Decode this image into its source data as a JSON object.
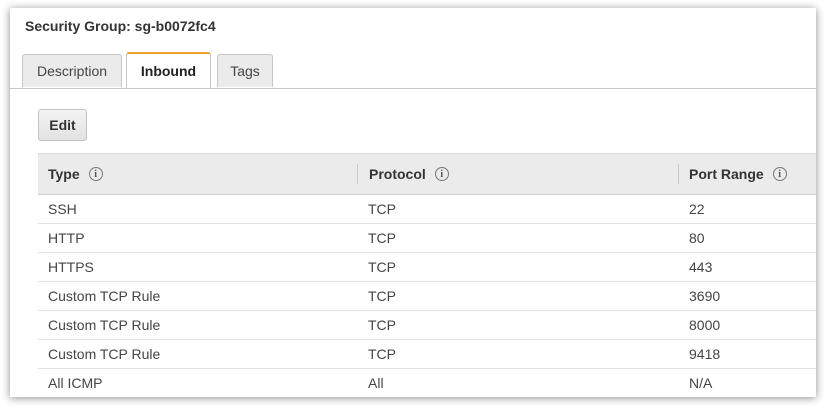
{
  "panel": {
    "title": "Security Group: sg-b0072fc4"
  },
  "tabs": [
    {
      "label": "Description",
      "active": false
    },
    {
      "label": "Inbound",
      "active": true
    },
    {
      "label": "Tags",
      "active": false
    }
  ],
  "toolbar": {
    "edit_label": "Edit"
  },
  "table": {
    "columns": [
      "Type",
      "Protocol",
      "Port Range"
    ],
    "info_icon": "info-icon",
    "rows": [
      {
        "type": "SSH",
        "protocol": "TCP",
        "port": "22"
      },
      {
        "type": "HTTP",
        "protocol": "TCP",
        "port": "80"
      },
      {
        "type": "HTTPS",
        "protocol": "TCP",
        "port": "443"
      },
      {
        "type": "Custom TCP Rule",
        "protocol": "TCP",
        "port": "3690"
      },
      {
        "type": "Custom TCP Rule",
        "protocol": "TCP",
        "port": "8000"
      },
      {
        "type": "Custom TCP Rule",
        "protocol": "TCP",
        "port": "9418"
      },
      {
        "type": "All ICMP",
        "protocol": "All",
        "port": "N/A"
      }
    ]
  },
  "colors": {
    "active_tab_accent": "#f0a22c",
    "header_bg": "#ebebeb"
  }
}
